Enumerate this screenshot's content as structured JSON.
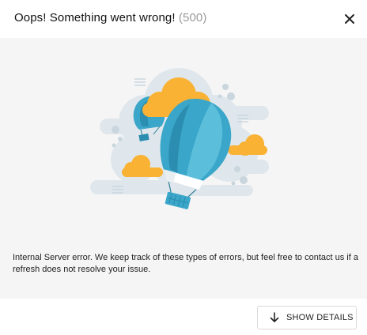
{
  "dialog": {
    "title": "Oops! Something went wrong!",
    "status_code": "(500)",
    "close_icon": "close-icon"
  },
  "illustration": {
    "name": "hot-air-balloons",
    "colors": {
      "balloon": "#3aa6c9",
      "cloud": "#f9b233",
      "background_cloud": "#dfe7ec"
    }
  },
  "message": "Internal Server error. We keep track of these types of errors, but feel free to contact us if a refresh does not resolve your issue.",
  "actions": {
    "show_details_label": "SHOW DETAILS",
    "show_details_icon": "arrow-down-icon"
  }
}
